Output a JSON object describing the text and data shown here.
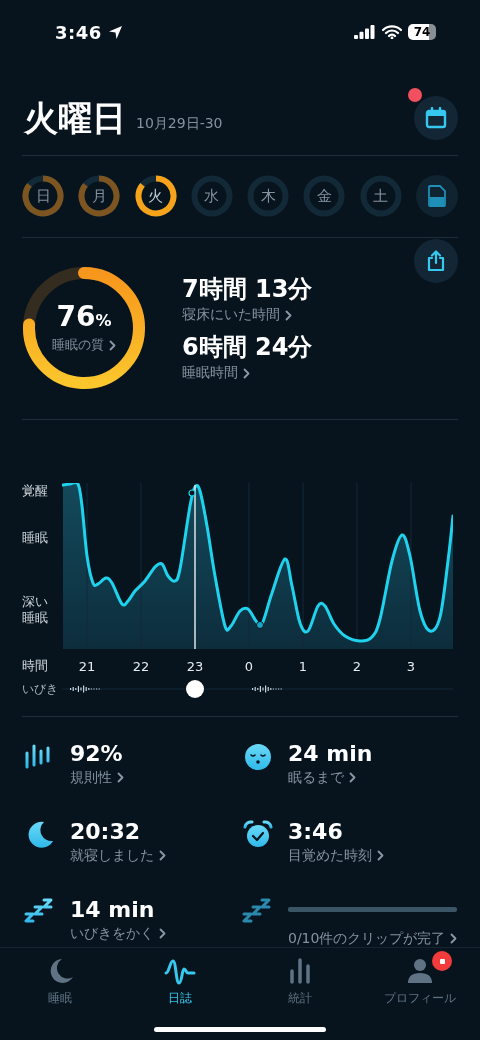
{
  "status_bar": {
    "time": "3:46",
    "battery": "74"
  },
  "header": {
    "title": "火曜日",
    "date_range": "10月29日-30",
    "calendar_badge": true
  },
  "days": [
    {
      "label": "日",
      "recorded": true,
      "selected": false
    },
    {
      "label": "月",
      "recorded": true,
      "selected": false
    },
    {
      "label": "火",
      "recorded": true,
      "selected": true
    },
    {
      "label": "水",
      "recorded": false,
      "selected": false
    },
    {
      "label": "木",
      "recorded": false,
      "selected": false
    },
    {
      "label": "金",
      "recorded": false,
      "selected": false
    },
    {
      "label": "土",
      "recorded": false,
      "selected": false
    }
  ],
  "summary": {
    "quality": {
      "value": "76",
      "unit": "%",
      "label": "睡眠の質"
    },
    "metrics": [
      {
        "value": "7時間 13分",
        "label": "寝床にいた時間"
      },
      {
        "value": "6時間 24分",
        "label": "睡眠時間"
      }
    ]
  },
  "hypnogram": {
    "y_labels": [
      "覚醒",
      "睡眠",
      "深い睡眠"
    ],
    "x_title": "時間",
    "hours": [
      "21",
      "22",
      "23",
      "0",
      "1",
      "2",
      "3"
    ],
    "snore_label": "いびき",
    "level": 0.34
  },
  "stats": [
    {
      "kind": "stat",
      "value": "92%",
      "label": "規則性"
    },
    {
      "kind": "stat",
      "value": "24 min",
      "label": "眠るまで"
    },
    {
      "kind": "stat",
      "value": "20:32",
      "label": "就寝しました"
    },
    {
      "kind": "stat",
      "value": "3:46",
      "label": "目覚めた時刻"
    },
    {
      "kind": "stat",
      "value": "14 min",
      "label": "いびきをかく"
    },
    {
      "kind": "progress",
      "label": "0/10件のクリップが完了"
    }
  ],
  "tabs": [
    {
      "label": "睡眠",
      "selected": false,
      "badge": false
    },
    {
      "label": "日誌",
      "selected": true,
      "badge": false
    },
    {
      "label": "統計",
      "selected": false,
      "badge": false
    },
    {
      "label": "プロフィール",
      "selected": false,
      "badge": true
    }
  ]
}
